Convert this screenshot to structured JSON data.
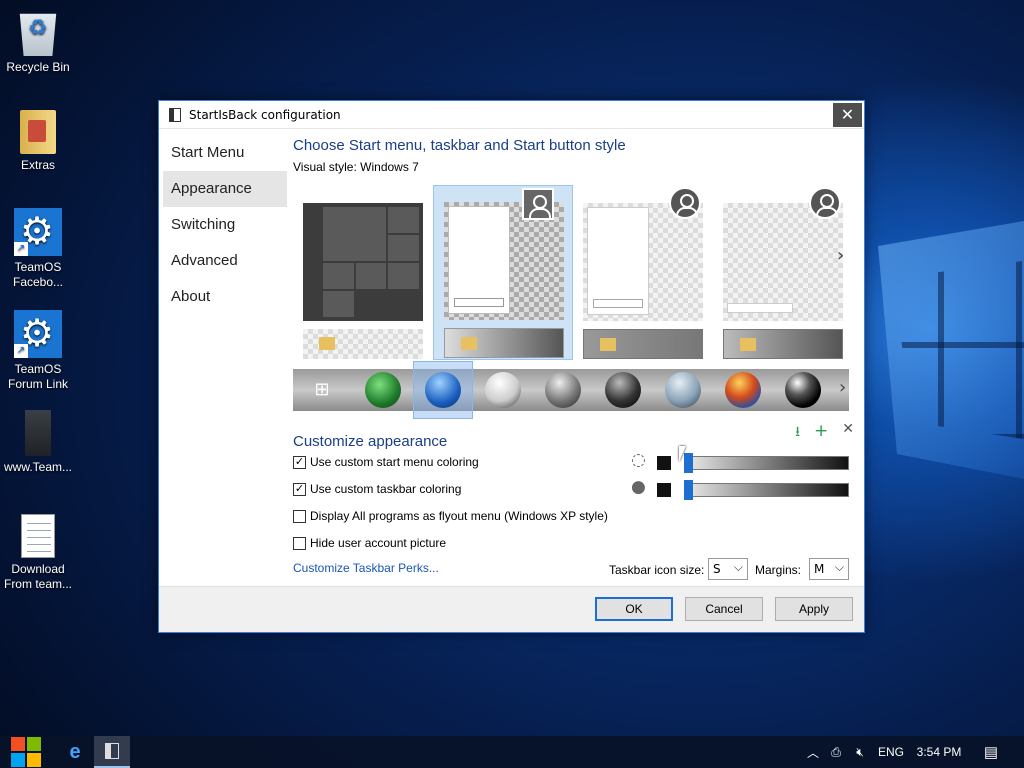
{
  "desktop": {
    "icons": [
      {
        "label": "Recycle Bin"
      },
      {
        "label": "Extras"
      },
      {
        "label": "TeamOS Facebo..."
      },
      {
        "label": "TeamOS Forum Link"
      },
      {
        "label": "www.Team..."
      },
      {
        "label": "Download From team..."
      }
    ]
  },
  "dialog": {
    "title": "StartIsBack configuration",
    "close_glyph": "✕",
    "nav": [
      "Start Menu",
      "Appearance",
      "Switching",
      "Advanced",
      "About"
    ],
    "selected_nav": "Appearance",
    "heading": "Choose Start menu, taskbar and Start button style",
    "visual_style_label": "Visual style:",
    "visual_style_value": "Windows 7",
    "customize_heading": "Customize appearance",
    "options": [
      {
        "label": "Use custom start menu coloring",
        "checked": true
      },
      {
        "label": "Use custom taskbar coloring",
        "checked": true
      },
      {
        "label": "Display All programs as flyout menu (Windows XP style)",
        "checked": false
      },
      {
        "label": "Hide user account picture",
        "checked": false
      }
    ],
    "sliders": [
      {
        "level": 0.02,
        "icon": "droplet-outline-icon"
      },
      {
        "level": 0.02,
        "icon": "droplet-filled-icon"
      }
    ],
    "perks_link": "Customize Taskbar Perks...",
    "icon_size_label": "Taskbar icon size:",
    "icon_size_value": "S",
    "margins_label": "Margins:",
    "margins_value": "M",
    "buttons": {
      "ok": "OK",
      "cancel": "Cancel",
      "apply": "Apply"
    },
    "accent": "#1a6fd1"
  },
  "taskbar": {
    "lang": "ENG",
    "time": "3:54 PM"
  }
}
